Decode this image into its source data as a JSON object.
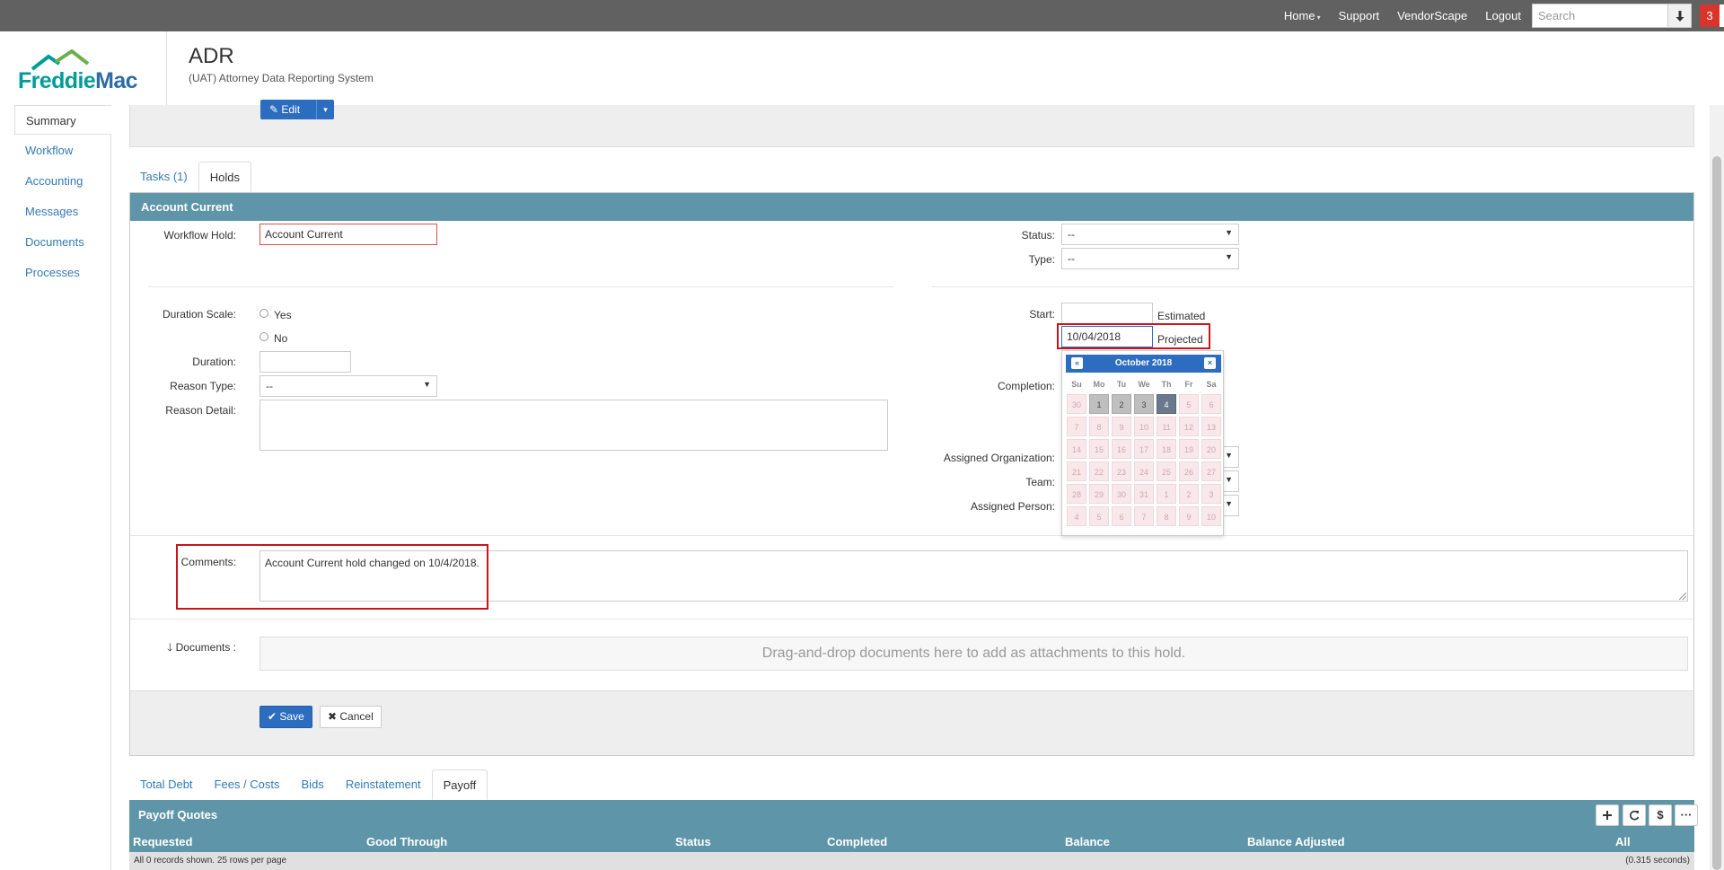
{
  "topnav": {
    "home": "Home",
    "support": "Support",
    "vendorscape": "VendorScape",
    "logout": "Logout",
    "search_placeholder": "Search",
    "badge": "3"
  },
  "brand": {
    "logo_freddie": "Freddie",
    "logo_mac": "Mac",
    "title": "ADR",
    "subtitle": "(UAT) Attorney Data Reporting System"
  },
  "sidebar": {
    "items": [
      "Summary",
      "Workflow",
      "Accounting",
      "Messages",
      "Documents",
      "Processes"
    ]
  },
  "edit_button": {
    "label": "Edit"
  },
  "tabs": [
    {
      "label": "Tasks (1)",
      "active": false
    },
    {
      "label": "Holds",
      "active": true
    }
  ],
  "hold": {
    "header": "Account Current",
    "workflow_hold_label": "Workflow Hold:",
    "workflow_hold_value": "Account Current",
    "status_label": "Status:",
    "status_value": "--",
    "type_label": "Type:",
    "type_value": "--",
    "duration_scale_label": "Duration Scale:",
    "yes_label": "Yes",
    "no_label": "No",
    "duration_label": "Duration:",
    "duration_value": "",
    "reason_type_label": "Reason Type:",
    "reason_type_value": "--",
    "reason_detail_label": "Reason Detail:",
    "reason_detail_value": "",
    "start_label": "Start:",
    "start_estimated_value": "",
    "estimated_label": "Estimated",
    "start_projected_value": "10/04/2018",
    "projected_label": "Projected",
    "completion_label": "Completion:",
    "assigned_org_label": "Assigned Organization:",
    "team_label": "Team:",
    "assigned_person_label": "Assigned Person:",
    "comments_label": "Comments:",
    "comments_value": "Account Current hold changed on 10/4/2018.",
    "documents_label": "Documents :",
    "dropzone_text": "Drag-and-drop documents here to add as attachments to this hold.",
    "save_label": "Save",
    "cancel_label": "Cancel"
  },
  "datepicker": {
    "month_label": "October 2018",
    "weekdays": [
      "Su",
      "Mo",
      "Tu",
      "We",
      "Th",
      "Fr",
      "Sa"
    ],
    "weeks": [
      [
        {
          "d": "30",
          "s": "dis"
        },
        {
          "d": "1",
          "s": "sel"
        },
        {
          "d": "2",
          "s": "sel"
        },
        {
          "d": "3",
          "s": "sel"
        },
        {
          "d": "4",
          "s": "today"
        },
        {
          "d": "5",
          "s": "dis"
        },
        {
          "d": "6",
          "s": "dis"
        }
      ],
      [
        {
          "d": "7",
          "s": "dis"
        },
        {
          "d": "8",
          "s": "dis"
        },
        {
          "d": "9",
          "s": "dis"
        },
        {
          "d": "10",
          "s": "dis"
        },
        {
          "d": "11",
          "s": "dis"
        },
        {
          "d": "12",
          "s": "dis"
        },
        {
          "d": "13",
          "s": "dis"
        }
      ],
      [
        {
          "d": "14",
          "s": "dis"
        },
        {
          "d": "15",
          "s": "dis"
        },
        {
          "d": "16",
          "s": "dis"
        },
        {
          "d": "17",
          "s": "dis"
        },
        {
          "d": "18",
          "s": "dis"
        },
        {
          "d": "19",
          "s": "dis"
        },
        {
          "d": "20",
          "s": "dis"
        }
      ],
      [
        {
          "d": "21",
          "s": "dis"
        },
        {
          "d": "22",
          "s": "dis"
        },
        {
          "d": "23",
          "s": "dis"
        },
        {
          "d": "24",
          "s": "dis"
        },
        {
          "d": "25",
          "s": "dis"
        },
        {
          "d": "26",
          "s": "dis"
        },
        {
          "d": "27",
          "s": "dis"
        }
      ],
      [
        {
          "d": "28",
          "s": "dis"
        },
        {
          "d": "29",
          "s": "dis"
        },
        {
          "d": "30",
          "s": "dis"
        },
        {
          "d": "31",
          "s": "dis"
        },
        {
          "d": "1",
          "s": "dis"
        },
        {
          "d": "2",
          "s": "dis"
        },
        {
          "d": "3",
          "s": "dis"
        }
      ],
      [
        {
          "d": "4",
          "s": "dis"
        },
        {
          "d": "5",
          "s": "dis"
        },
        {
          "d": "6",
          "s": "dis"
        },
        {
          "d": "7",
          "s": "dis"
        },
        {
          "d": "8",
          "s": "dis"
        },
        {
          "d": "9",
          "s": "dis"
        },
        {
          "d": "10",
          "s": "dis"
        }
      ]
    ]
  },
  "accounting_tabs": [
    {
      "label": "Total Debt",
      "active": false
    },
    {
      "label": "Fees / Costs",
      "active": false
    },
    {
      "label": "Bids",
      "active": false
    },
    {
      "label": "Reinstatement",
      "active": false
    },
    {
      "label": "Payoff",
      "active": true
    }
  ],
  "payoff": {
    "title": "Payoff Quotes",
    "columns": [
      "Requested",
      "Good Through",
      "Status",
      "Completed",
      "Balance",
      "Balance Adjusted",
      "All"
    ],
    "records_text": "All 0 records shown. 25 rows per page",
    "timing_text": "(0.315 seconds)",
    "toolbar_icons": [
      "plus-icon",
      "refresh-icon",
      "dollar-icon",
      "more-icon"
    ]
  },
  "colors": {
    "topbar": "#616161",
    "panel_header": "#5e95a8",
    "primary": "#2c6dbf",
    "link": "#337ab7",
    "highlight_red": "#c9141e",
    "badge": "#d9342b"
  }
}
